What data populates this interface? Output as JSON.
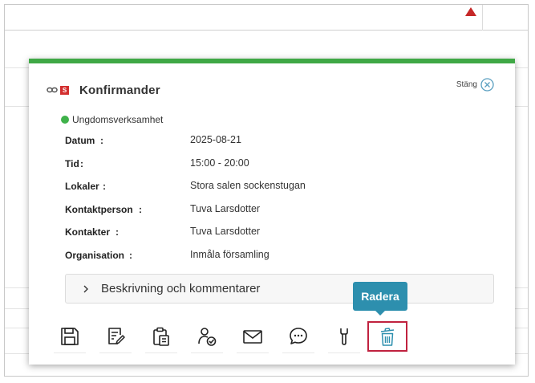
{
  "popup": {
    "title": "Konfirmander",
    "badge": "S",
    "close_label": "Stäng",
    "category": {
      "label": "Ungdomsverksamhet",
      "color": "#3fb24a"
    },
    "accent_color": "#3fa846",
    "details": [
      {
        "label": "Datum",
        "value": "2025-08-21"
      },
      {
        "label": "Tid",
        "value": "15:00 - 20:00"
      },
      {
        "label": "Lokaler",
        "value": "Stora salen sockenstugan"
      },
      {
        "label": "Kontaktperson",
        "value": "Tuva Larsdotter"
      },
      {
        "label": "Kontakter",
        "value": "Tuva Larsdotter"
      },
      {
        "label": "Organisation",
        "value": "Inmåla församling"
      }
    ],
    "accordion_label": "Beskrivning och kommentarer"
  },
  "toolbar": {
    "icons": [
      "save-icon",
      "edit-document-icon",
      "clipboard-icon",
      "person-check-icon",
      "mail-icon",
      "chat-icon",
      "wrench-icon",
      "trash-icon"
    ],
    "tooltip": "Radera"
  }
}
